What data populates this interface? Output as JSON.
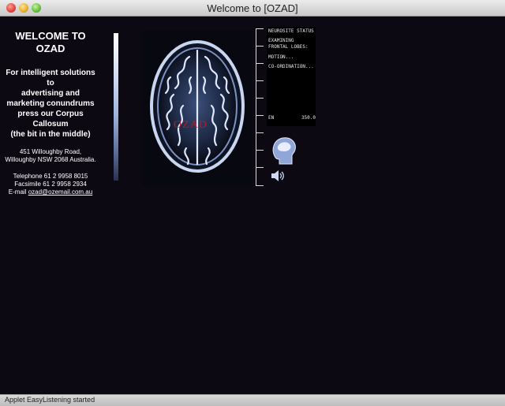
{
  "window": {
    "title": "Welcome to [OZAD]"
  },
  "left": {
    "welcome_line1": "WELCOME TO",
    "welcome_line2": "OZAD",
    "tagline": [
      "For intelligent solutions to",
      "advertising and",
      "marketing conundrums",
      "press our Corpus",
      "Callosum",
      "(the bit in the middle)"
    ],
    "address": [
      "451 Willoughby Road,",
      "Willoughby NSW 2068 Australia."
    ],
    "telephone": "Telephone 61 2 9958 8015",
    "facsimile": "Facsimile 61 2 9958 2934",
    "email_prefix": "E-mail ",
    "email": "ozad@ozemail.com.au"
  },
  "brain": {
    "overlay": "OZAD"
  },
  "status_panel": {
    "title": "NEUROSITE STATUS",
    "examining": "EXAMINING",
    "frontal": "FRONTAL LOBES:",
    "motion": "MOTION...",
    "coordination": "CO-ORDINATION...",
    "en_label": "EN",
    "en_value": "350.0"
  },
  "icons": {
    "head": "head-scan-icon",
    "speaker": "speaker-icon"
  },
  "statusbar": {
    "text": "Applet EasyListening started"
  }
}
